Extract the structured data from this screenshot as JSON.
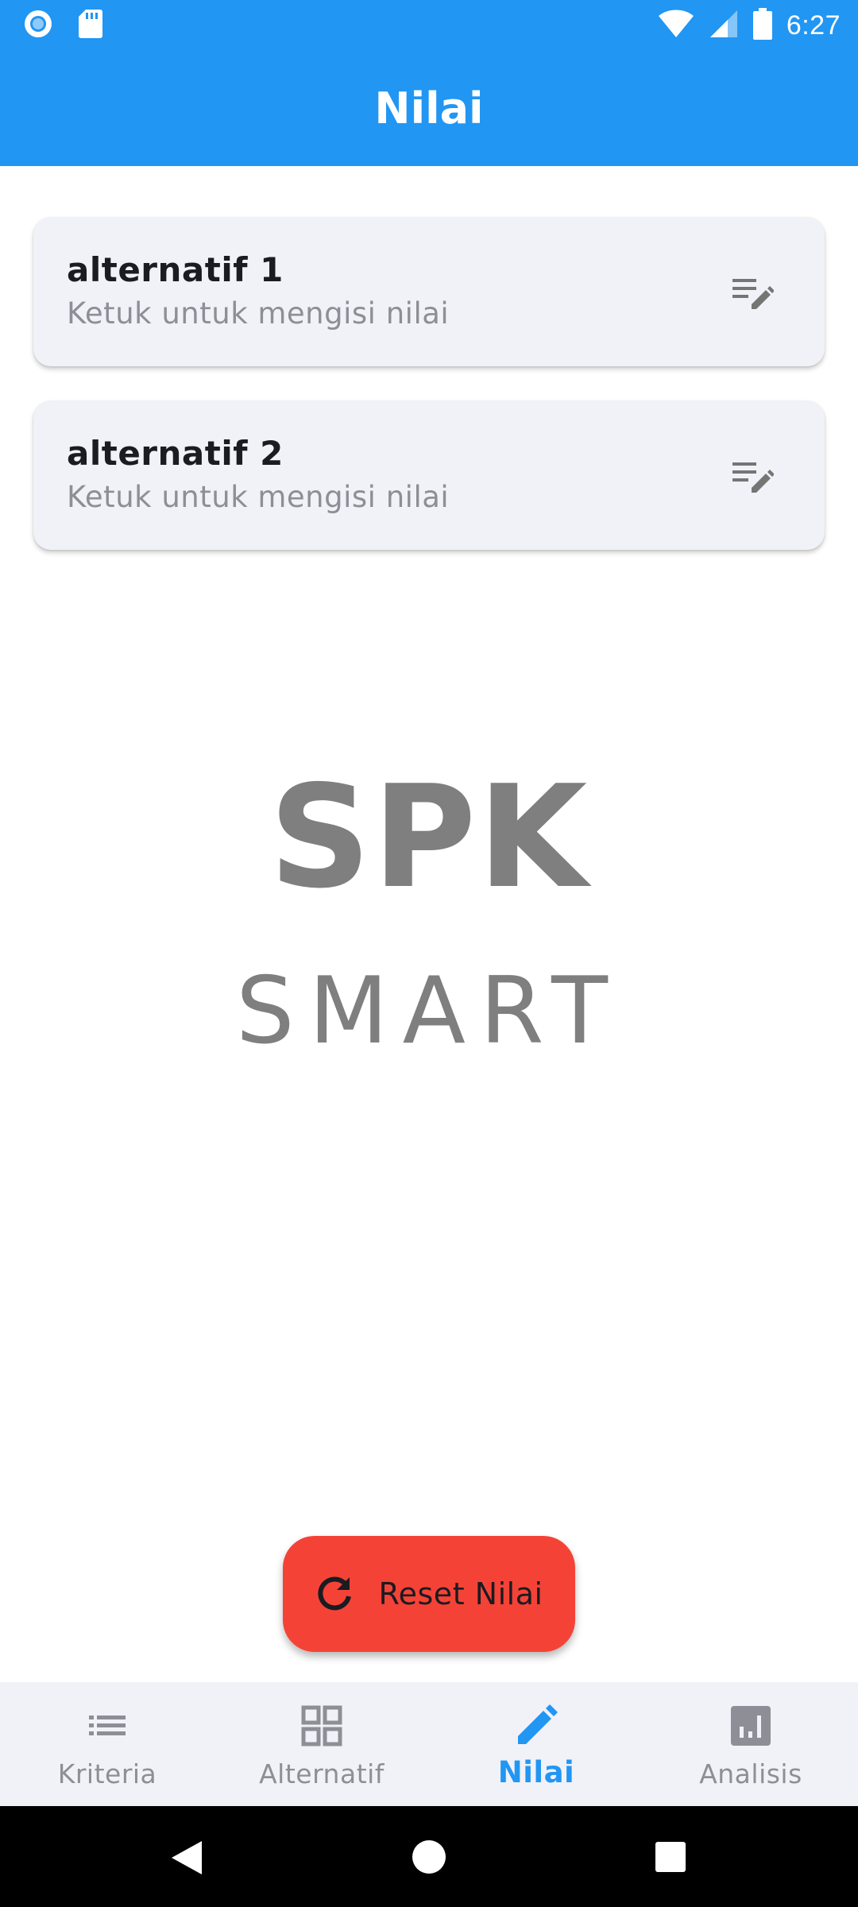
{
  "status_bar": {
    "time": "6:27",
    "left_icons": [
      "record-icon",
      "sd-card-icon"
    ],
    "right_icons": [
      "wifi-icon",
      "cell-signal-icon",
      "battery-icon"
    ]
  },
  "app_bar": {
    "title": "Nilai",
    "color": "#2196f3"
  },
  "alternatives": [
    {
      "name": "alternatif 1",
      "hint": "Ketuk untuk mengisi nilai",
      "icon": "edit-note-icon"
    },
    {
      "name": "alternatif 2",
      "hint": "Ketuk untuk mengisi nilai",
      "icon": "edit-note-icon"
    }
  ],
  "logo": {
    "line1": "SPK",
    "line2": "SMART"
  },
  "fab": {
    "label": "Reset Nilai",
    "icon": "refresh-icon",
    "color": "#f44336"
  },
  "bottom_nav": {
    "items": [
      {
        "label": "Kriteria",
        "icon": "list-icon",
        "active": false
      },
      {
        "label": "Alternatif",
        "icon": "grid-icon",
        "active": false
      },
      {
        "label": "Nilai",
        "icon": "pencil-icon",
        "active": true
      },
      {
        "label": "Analisis",
        "icon": "bar-chart-icon",
        "active": false
      }
    ],
    "active_color": "#2196f3"
  },
  "system_nav": [
    "back-icon",
    "home-icon",
    "recents-icon"
  ]
}
